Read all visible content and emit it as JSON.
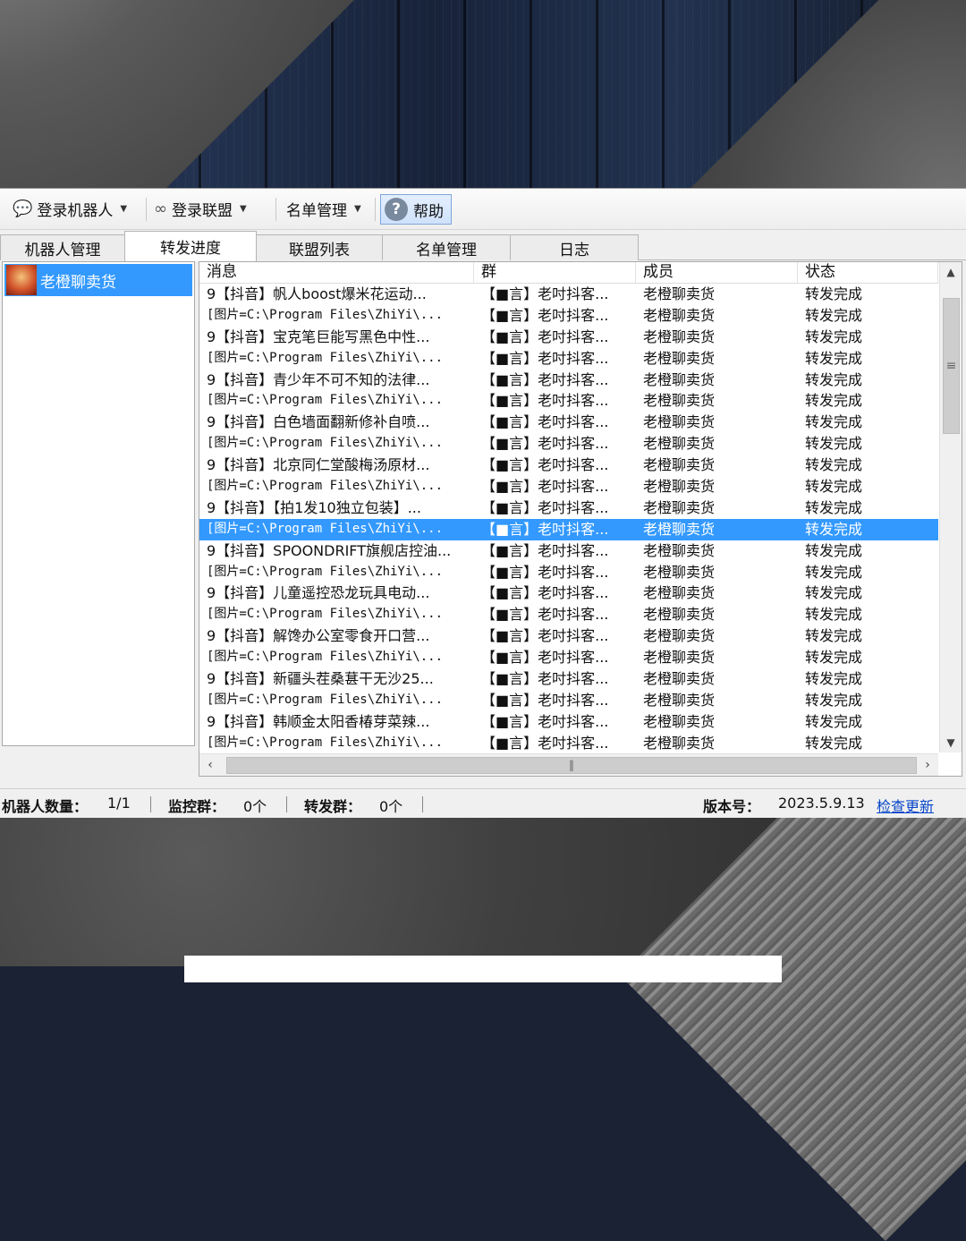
{
  "toolbar": {
    "login_robot": "登录机器人",
    "login_alliance": "登录联盟",
    "list_manage": "名单管理",
    "help": "帮助"
  },
  "tabs": [
    {
      "label": "机器人管理"
    },
    {
      "label": "转发进度"
    },
    {
      "label": "联盟列表"
    },
    {
      "label": "名单管理"
    },
    {
      "label": "日志"
    }
  ],
  "left_panel": {
    "robot_name": "老橙聊卖货"
  },
  "grid": {
    "headers": [
      "消息",
      "群",
      "成员",
      "状态"
    ],
    "selected_row": 11,
    "rows": [
      {
        "msg": "9【抖音】帆人boost爆米花运动...",
        "group": "【■言】老吋抖客...",
        "member": "老橙聊卖货",
        "status": "转发完成"
      },
      {
        "msg": "[图片=C:\\Program Files\\ZhiYi\\...",
        "group": "【■言】老吋抖客...",
        "member": "老橙聊卖货",
        "status": "转发完成"
      },
      {
        "msg": "9【抖音】宝克笔巨能写黑色中性...",
        "group": "【■言】老吋抖客...",
        "member": "老橙聊卖货",
        "status": "转发完成"
      },
      {
        "msg": "[图片=C:\\Program Files\\ZhiYi\\...",
        "group": "【■言】老吋抖客...",
        "member": "老橙聊卖货",
        "status": "转发完成"
      },
      {
        "msg": "9【抖音】青少年不可不知的法律...",
        "group": "【■言】老吋抖客...",
        "member": "老橙聊卖货",
        "status": "转发完成"
      },
      {
        "msg": "[图片=C:\\Program Files\\ZhiYi\\...",
        "group": "【■言】老吋抖客...",
        "member": "老橙聊卖货",
        "status": "转发完成"
      },
      {
        "msg": "9【抖音】白色墙面翻新修补自喷...",
        "group": "【■言】老吋抖客...",
        "member": "老橙聊卖货",
        "status": "转发完成"
      },
      {
        "msg": "[图片=C:\\Program Files\\ZhiYi\\...",
        "group": "【■言】老吋抖客...",
        "member": "老橙聊卖货",
        "status": "转发完成"
      },
      {
        "msg": "9【抖音】北京同仁堂酸梅汤原材...",
        "group": "【■言】老吋抖客...",
        "member": "老橙聊卖货",
        "status": "转发完成"
      },
      {
        "msg": "[图片=C:\\Program Files\\ZhiYi\\...",
        "group": "【■言】老吋抖客...",
        "member": "老橙聊卖货",
        "status": "转发完成"
      },
      {
        "msg": "9【抖音】【拍1发10独立包装】...",
        "group": "【■言】老吋抖客...",
        "member": "老橙聊卖货",
        "status": "转发完成"
      },
      {
        "msg": "[图片=C:\\Program Files\\ZhiYi\\...",
        "group": "【■言】老吋抖客...",
        "member": "老橙聊卖货",
        "status": "转发完成"
      },
      {
        "msg": "9【抖音】SPOONDRIFT旗舰店控油...",
        "group": "【■言】老吋抖客...",
        "member": "老橙聊卖货",
        "status": "转发完成"
      },
      {
        "msg": "[图片=C:\\Program Files\\ZhiYi\\...",
        "group": "【■言】老吋抖客...",
        "member": "老橙聊卖货",
        "status": "转发完成"
      },
      {
        "msg": "9【抖音】儿童遥控恐龙玩具电动...",
        "group": "【■言】老吋抖客...",
        "member": "老橙聊卖货",
        "status": "转发完成"
      },
      {
        "msg": "[图片=C:\\Program Files\\ZhiYi\\...",
        "group": "【■言】老吋抖客...",
        "member": "老橙聊卖货",
        "status": "转发完成"
      },
      {
        "msg": "9【抖音】解馋办公室零食开口营...",
        "group": "【■言】老吋抖客...",
        "member": "老橙聊卖货",
        "status": "转发完成"
      },
      {
        "msg": "[图片=C:\\Program Files\\ZhiYi\\...",
        "group": "【■言】老吋抖客...",
        "member": "老橙聊卖货",
        "status": "转发完成"
      },
      {
        "msg": "9【抖音】新疆头茬桑葚干无沙25...",
        "group": "【■言】老吋抖客...",
        "member": "老橙聊卖货",
        "status": "转发完成"
      },
      {
        "msg": "[图片=C:\\Program Files\\ZhiYi\\...",
        "group": "【■言】老吋抖客...",
        "member": "老橙聊卖货",
        "status": "转发完成"
      },
      {
        "msg": "9【抖音】韩顺金太阳香椿芽菜辣...",
        "group": "【■言】老吋抖客...",
        "member": "老橙聊卖货",
        "status": "转发完成"
      },
      {
        "msg": "[图片=C:\\Program Files\\ZhiYi\\...",
        "group": "【■言】老吋抖客...",
        "member": "老橙聊卖货",
        "status": "转发完成"
      }
    ]
  },
  "statusbar": {
    "robot_count_label": "机器人数量：",
    "robot_count": "1/1",
    "monitor_label": "监控群：",
    "monitor_value": "0个",
    "forward_label": "转发群：",
    "forward_value": "0个",
    "version_label": "版本号：",
    "version_value": "2023.5.9.13",
    "check_update": "检查更新"
  },
  "icons": {
    "login_robot": "wechat-icon",
    "login_alliance": "link-icon",
    "help": "help-icon"
  }
}
